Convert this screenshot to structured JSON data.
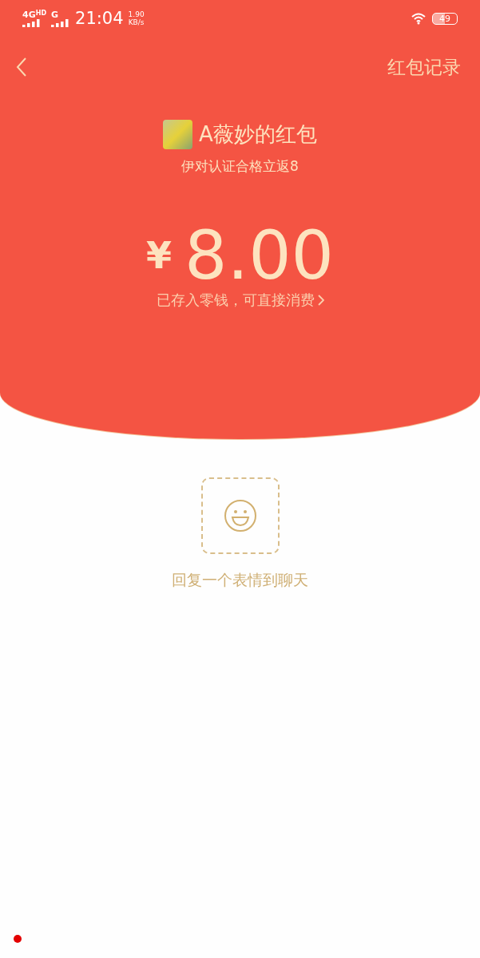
{
  "status_bar": {
    "network_1": "4G",
    "network_1_badge": "HD",
    "network_2": "G",
    "time": "21:04",
    "speed_value": "1.90",
    "speed_unit": "KB/s",
    "battery": "49"
  },
  "nav": {
    "records_link": "红包记录"
  },
  "packet": {
    "sender": "A薇妙的红包",
    "message": "伊对认证合格立返8",
    "currency": "¥",
    "amount": "8.00",
    "note": "已存入零钱，可直接消费"
  },
  "reply": {
    "label": "回复一个表情到聊天"
  }
}
